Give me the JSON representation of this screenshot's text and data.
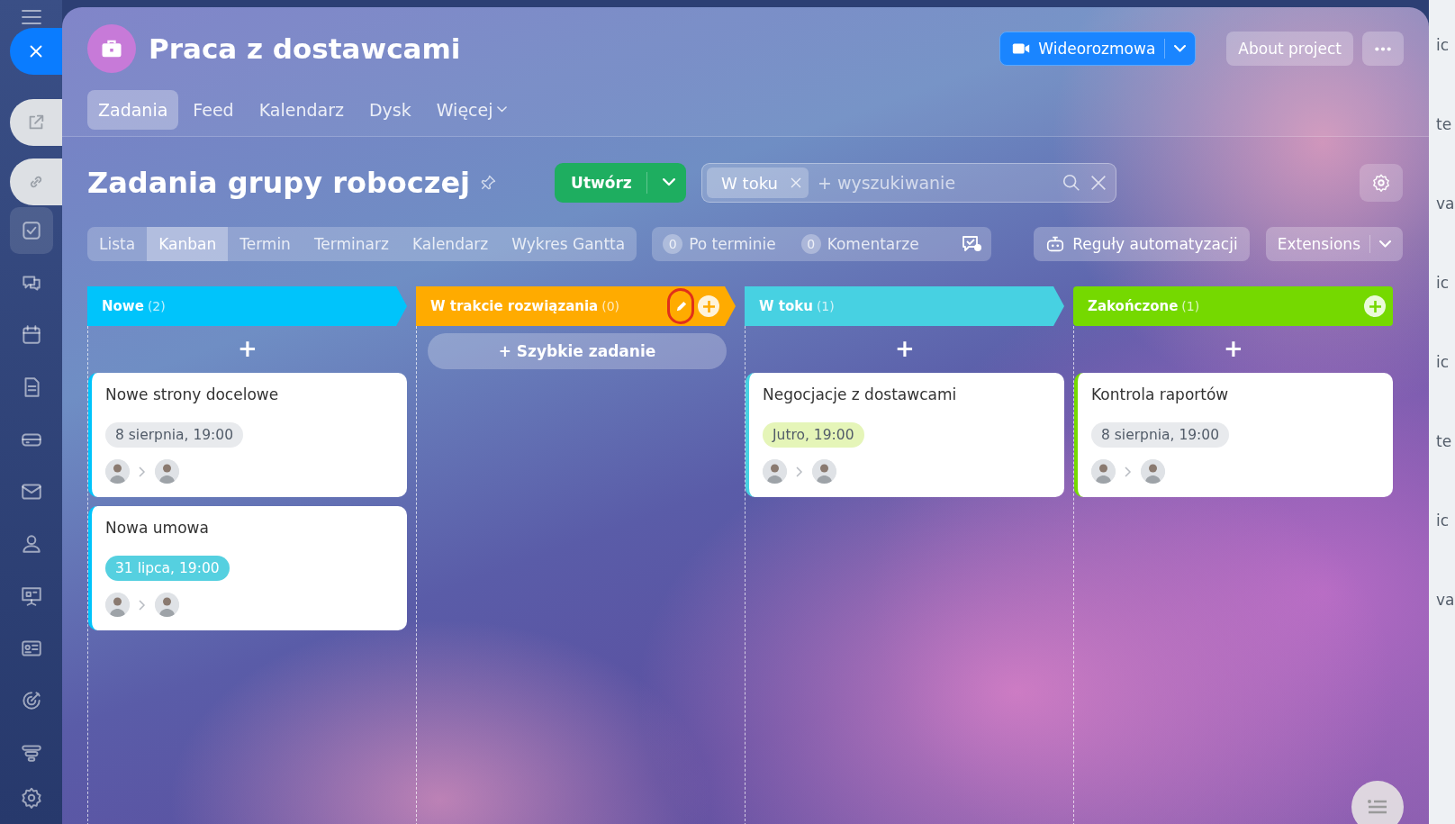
{
  "sidebar": {
    "items": [
      {
        "kind": "check",
        "selected": true
      },
      {
        "kind": "chat",
        "selected": false
      },
      {
        "kind": "calendar",
        "selected": false
      },
      {
        "kind": "document",
        "selected": false
      },
      {
        "kind": "drive",
        "selected": false
      },
      {
        "kind": "mail",
        "selected": false
      },
      {
        "kind": "people",
        "selected": false
      },
      {
        "kind": "board",
        "selected": false
      },
      {
        "kind": "contact",
        "selected": false
      },
      {
        "kind": "target",
        "selected": false
      },
      {
        "kind": "funnel",
        "selected": false
      }
    ]
  },
  "project": {
    "title": "Praca z dostawcami",
    "video_button": "Wideorozmowa",
    "about_button": "About project",
    "tabs": [
      {
        "label": "Zadania",
        "selected": true,
        "dropdown": false
      },
      {
        "label": "Feed",
        "selected": false,
        "dropdown": false
      },
      {
        "label": "Kalendarz",
        "selected": false,
        "dropdown": false
      },
      {
        "label": "Dysk",
        "selected": false,
        "dropdown": false
      },
      {
        "label": "Więcej",
        "selected": false,
        "dropdown": true
      }
    ]
  },
  "page_title": "Zadania grupy roboczej",
  "create_button": "Utwórz",
  "filter": {
    "chips": [
      "W toku"
    ],
    "placeholder": "+ wyszukiwanie"
  },
  "views": [
    {
      "label": "Lista",
      "selected": false
    },
    {
      "label": "Kanban",
      "selected": true
    },
    {
      "label": "Termin",
      "selected": false
    },
    {
      "label": "Terminarz",
      "selected": false
    },
    {
      "label": "Kalendarz",
      "selected": false
    },
    {
      "label": "Wykres Gantta",
      "selected": false
    }
  ],
  "counters": [
    {
      "count": "0",
      "label": "Po terminie"
    },
    {
      "count": "0",
      "label": "Komentarze"
    }
  ],
  "automation_button": "Reguły automatyzacji",
  "extensions_button": "Extensions",
  "columns": [
    {
      "title": "Nowe",
      "count": "(2)",
      "color": "#00c4fb",
      "editable": false,
      "add_button": false,
      "quick_add": {
        "kind": "plus",
        "text": "+"
      },
      "cards": [
        {
          "title": "Nowe strony docelowe",
          "deadline": {
            "text": "8 sierpnia, 19:00",
            "color": "#e8eaed"
          }
        },
        {
          "title": "Nowa umowa",
          "deadline": {
            "text": "31 lipca, 19:00",
            "color": "#55d0e0"
          }
        }
      ]
    },
    {
      "title": "W trakcie rozwiązania",
      "count": "(0)",
      "color": "#ffab00",
      "editable": true,
      "add_button": true,
      "quick_add": {
        "kind": "button",
        "text": "+ Szybkie zadanie"
      }
    },
    {
      "title": "W toku",
      "count": "(1)",
      "color": "#47d1e2",
      "editable": false,
      "add_button": false,
      "quick_add": {
        "kind": "plus",
        "text": "+"
      },
      "cards": [
        {
          "title": "Negocjacje z dostawcami",
          "deadline": {
            "text": "Jutro, 19:00",
            "color": "#e5f5b8"
          }
        }
      ]
    },
    {
      "title": "Zakończone",
      "count": "(1)",
      "color": "#75d900",
      "editable": false,
      "add_button": true,
      "quick_add": {
        "kind": "plus",
        "text": "+"
      },
      "cards": [
        {
          "title": "Kontrola raportów",
          "deadline": {
            "text": "8 sierpnia, 19:00",
            "color": "#e8eaed"
          }
        }
      ]
    }
  ],
  "background_page": {
    "fragments": [
      "ic",
      "te",
      "va",
      "ic",
      "ic",
      "te",
      "ic",
      "va"
    ]
  }
}
